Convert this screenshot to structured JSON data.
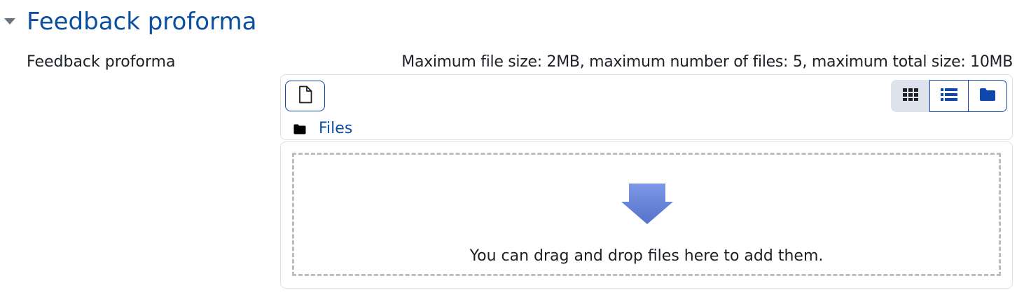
{
  "section": {
    "title": "Feedback proforma",
    "toggle_icon": "caret-down-icon"
  },
  "field": {
    "label": "Feedback proforma",
    "restrictions": "Maximum file size: 2MB, maximum number of files: 5, maximum total size: 10MB"
  },
  "filemanager": {
    "add_button_icon": "file-icon",
    "views": [
      {
        "name": "icons",
        "icon": "grid-icon",
        "active": true
      },
      {
        "name": "list",
        "icon": "list-icon",
        "active": false
      },
      {
        "name": "tree",
        "icon": "folder-icon",
        "active": false
      }
    ],
    "path": {
      "icon": "folder-icon",
      "label": "Files"
    },
    "dropzone": {
      "icon": "down-arrow-icon",
      "message": "You can drag and drop files here to add them."
    }
  },
  "colors": {
    "link": "#0a4fa0",
    "button_border": "#0f47ad",
    "active_view_bg": "#dee2ec",
    "dropzone_border": "#b8bec4",
    "arrow": "#6b86d8"
  }
}
